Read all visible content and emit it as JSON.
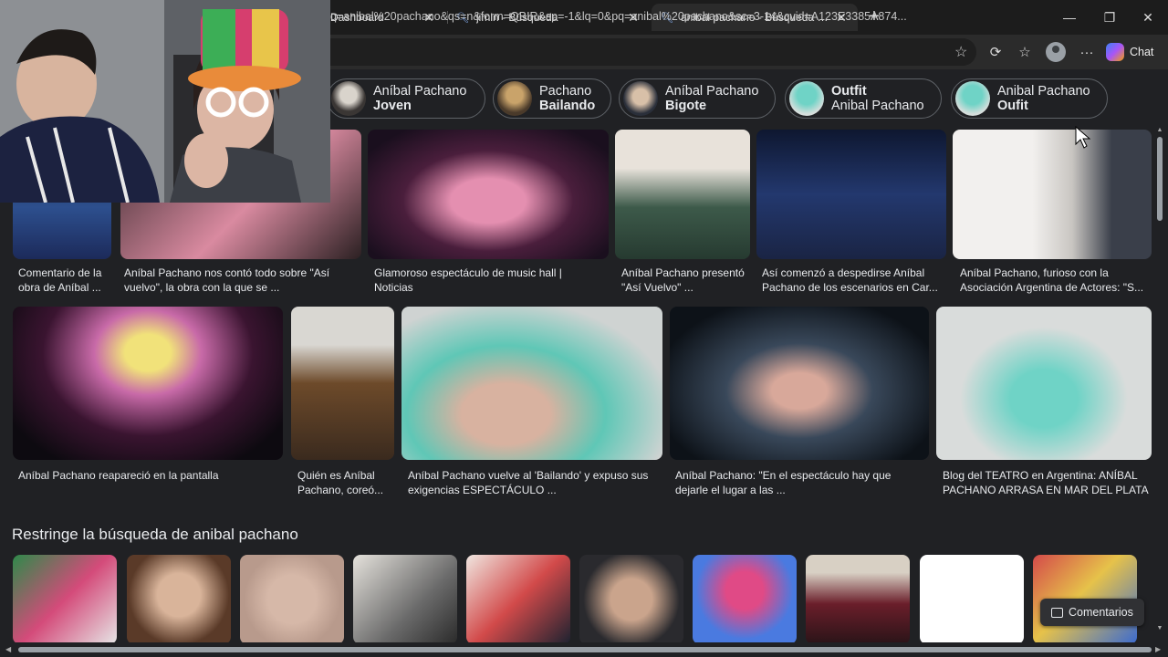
{
  "tabs": [
    {
      "title": "Dashboard"
    },
    {
      "title": "jimin - Búsqueda"
    },
    {
      "title": "anibal pachano - Búsqueda Imágenes"
    }
  ],
  "address": {
    "url": "q=anibal%20pachano&qs=n&form=QBIR&sp=-1&lq=0&pq=anibal%20pachano&sc=3-14&cvid=A123E3385A874..."
  },
  "toolbar": {
    "chat_label": "Chat"
  },
  "chips": [
    {
      "line1": "Aníbal Pachano",
      "line2": "Joven"
    },
    {
      "line1": "Pachano",
      "line2": "Bailando"
    },
    {
      "line1": "Aníbal Pachano",
      "line2": "Bigote"
    },
    {
      "line1": "Outfit",
      "line2": "Anibal Pachano"
    },
    {
      "line1": "Anibal Pachano",
      "line2": "Oufit"
    }
  ],
  "row1_captions": [
    "Comentario de la obra de Aníbal ...",
    "Aníbal Pachano nos contó todo sobre \"Así vuelvo\", la obra con la que se ...",
    "Glamoroso espectáculo de music hall | Noticias",
    "Aníbal Pachano presentó \"Así Vuelvo\" ...",
    "Así comenzó a despedirse Aníbal Pachano de los escenarios en Car...",
    "Aníbal Pachano, furioso con la Asociación Argentina de Actores: \"S..."
  ],
  "row2_captions": [
    "Aníbal Pachano reapareció en la pantalla",
    "Quién es Aníbal Pachano, coreó...",
    "Aníbal Pachano vuelve al 'Bailando' y expuso sus exigencias ESPECTÁCULO ...",
    "Aníbal Pachano: \"En el espectáculo hay que dejarle el lugar a las ...",
    "Blog del TEATRO en Argentina: ANÍBAL PACHANO ARRASA EN MAR DEL PLATA"
  ],
  "section": {
    "title": "Restringe la búsqueda de anibal pachano"
  },
  "feedback": {
    "label": "Comentarios"
  }
}
